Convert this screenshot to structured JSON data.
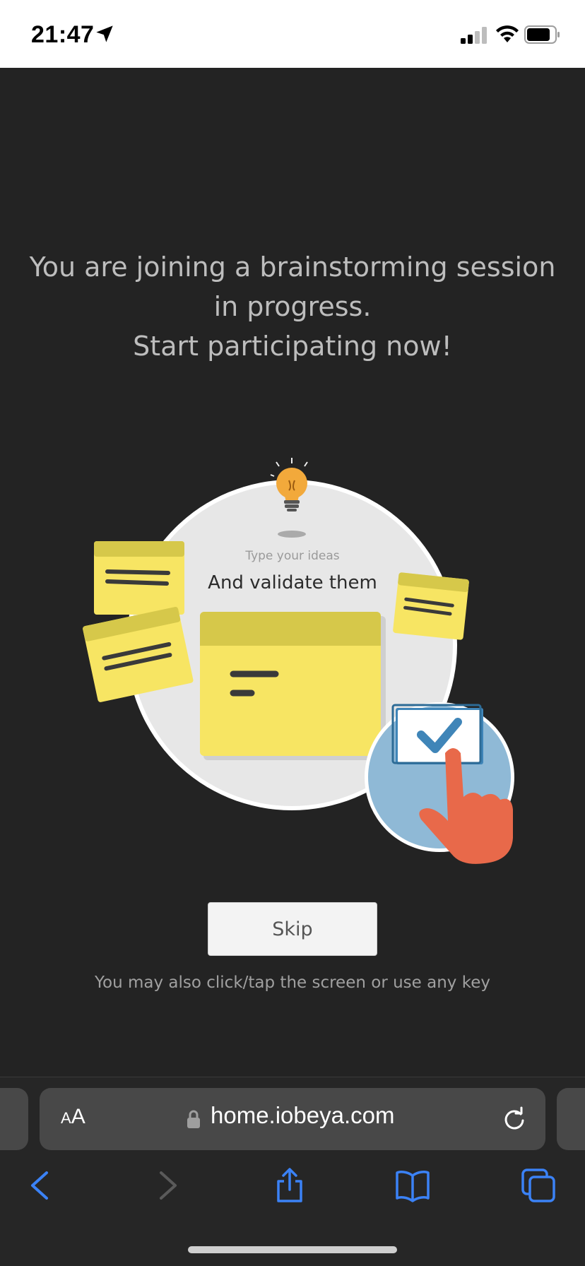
{
  "status_bar": {
    "time": "21:47",
    "icons": [
      "location-arrow-icon",
      "cellular-signal-icon",
      "wifi-icon",
      "battery-icon"
    ]
  },
  "intro": {
    "headline_lines": [
      "You are joining a brainstorming session",
      "in progress.",
      "Start participating now!"
    ],
    "illustration": {
      "caption_small": "Type your ideas",
      "caption_main": "And validate them"
    },
    "skip_label": "Skip",
    "hint": "You may also click/tap the screen or use any key"
  },
  "browser": {
    "text_size_small": "A",
    "text_size_large": "A",
    "url": "home.iobeya.com",
    "toolbar_icons": [
      "back-icon",
      "forward-icon",
      "share-icon",
      "bookmarks-icon",
      "tabs-icon"
    ]
  },
  "colors": {
    "background": "#232323",
    "sticky_yellow": "#f7e563",
    "sticky_header": "#d6c84a",
    "check_blue": "#3f85b8",
    "hand_orange": "#e8694a",
    "ios_blue": "#3b82f6"
  }
}
